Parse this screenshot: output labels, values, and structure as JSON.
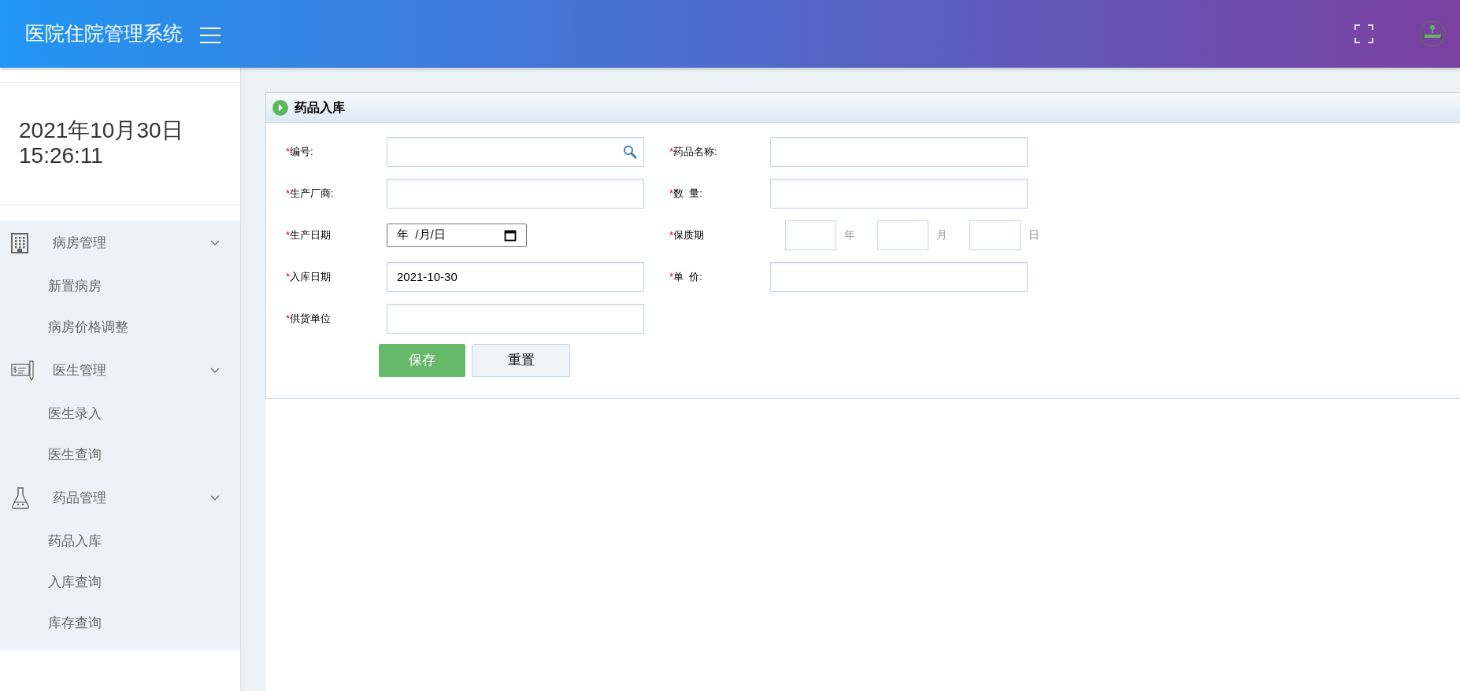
{
  "header": {
    "title": "医院住院管理系统"
  },
  "sidebar": {
    "date": "2021年10月30日",
    "time": "15:26:11",
    "groups": [
      {
        "kind": "building",
        "label": "病房管理",
        "expanded": true,
        "children": [
          {
            "label": "新置病房"
          },
          {
            "label": "病房价格调整"
          }
        ]
      },
      {
        "kind": "cheque",
        "label": "医生管理",
        "expanded": true,
        "children": [
          {
            "label": "医生录入"
          },
          {
            "label": "医生查询"
          }
        ]
      },
      {
        "kind": "flask",
        "label": "药品管理",
        "expanded": true,
        "children": [
          {
            "label": "药品入库"
          },
          {
            "label": "入库查询"
          },
          {
            "label": "库存查询"
          }
        ]
      }
    ]
  },
  "panel": {
    "title": "药品入库",
    "rows": [
      [
        {
          "kind": "search",
          "mark": "*",
          "label": "编号:"
        },
        {
          "kind": "text",
          "mark": "*",
          "label": "药品名称:"
        }
      ],
      [
        {
          "kind": "text",
          "mark": "*",
          "label": "生产厂商:"
        },
        {
          "kind": "text",
          "mark": "*",
          "label": "数  量:"
        }
      ],
      [
        {
          "kind": "date",
          "mark": "*",
          "label": "生产日期",
          "placeholder": "年  /月/日"
        },
        {
          "kind": "parts",
          "mark": "*",
          "label": "保质期",
          "units": [
            "年",
            "月",
            "日"
          ]
        }
      ],
      [
        {
          "kind": "text",
          "mark": "*",
          "label": "入库日期",
          "value": "2021-10-30"
        },
        {
          "kind": "text",
          "mark": "*",
          "label": "单  价:"
        }
      ],
      [
        {
          "kind": "text",
          "mark": "*",
          "label": "供货单位"
        }
      ]
    ],
    "buttons": [
      {
        "kind": "primary",
        "label": "保存"
      },
      {
        "kind": "secondary",
        "label": "重置"
      }
    ]
  }
}
